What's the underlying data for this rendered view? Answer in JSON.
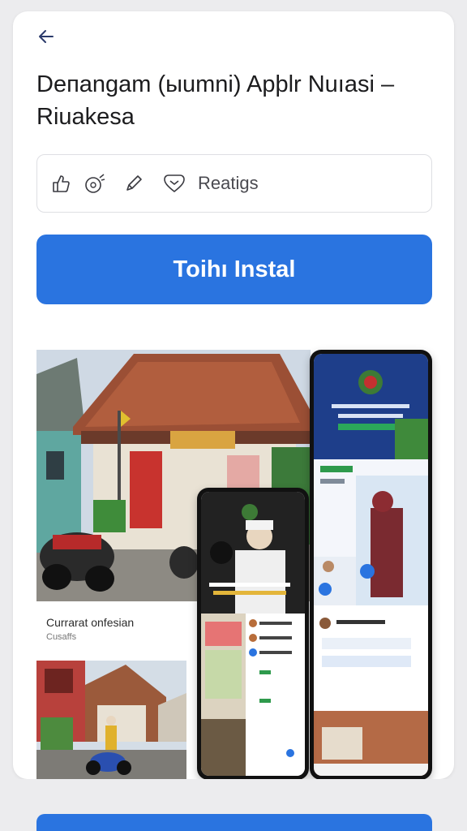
{
  "header": {
    "back_icon": "arrow-left-icon"
  },
  "app": {
    "title_line1": "Deпangam (ыumni) Apþlr Nuıasi –",
    "title_line2": "Riuakesa"
  },
  "actions": {
    "icons": [
      "thumbs-up-icon",
      "chat-bubble-icon",
      "pencil-icon",
      "heart-icon"
    ],
    "label": "Reatigs"
  },
  "install": {
    "label": "Toihı Instal",
    "color": "#2a74e0"
  },
  "gallery": {
    "caption_title": "Currarat onfesian",
    "caption_sub": "Cusaffs"
  }
}
